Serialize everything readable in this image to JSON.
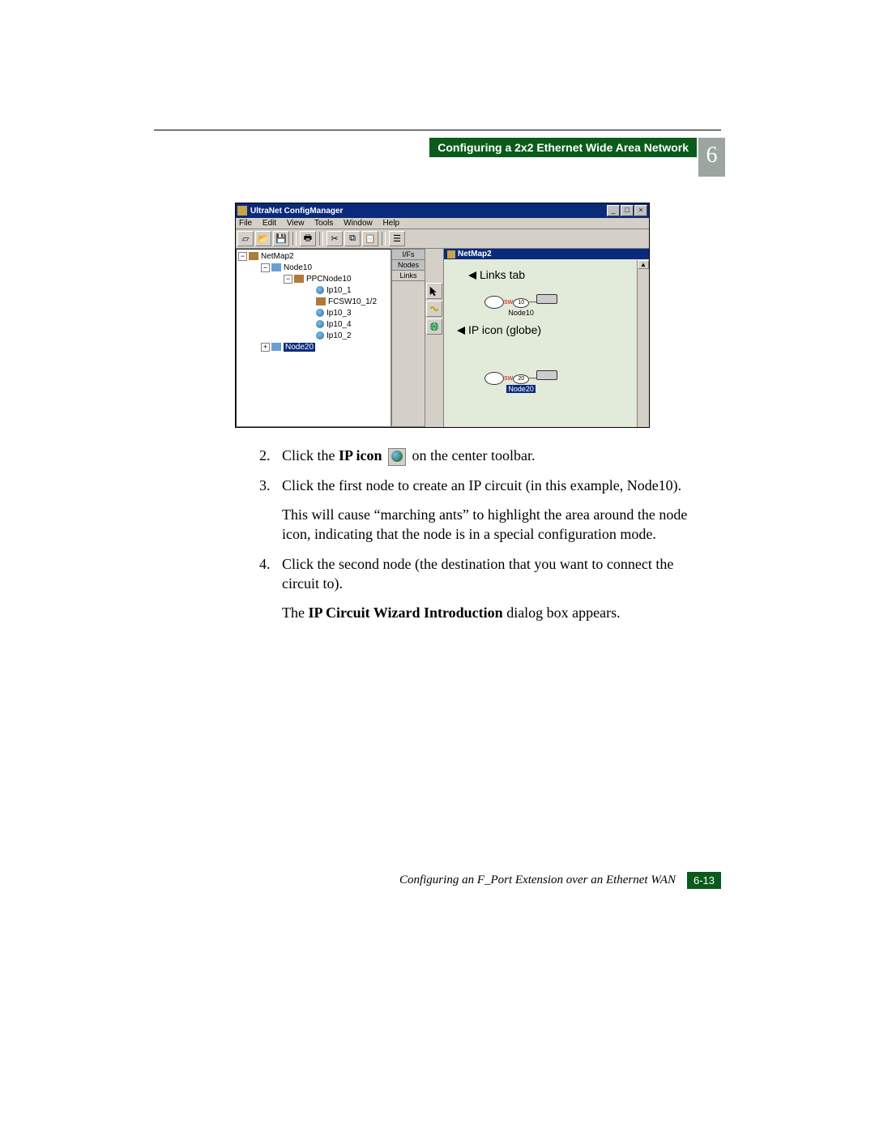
{
  "header": {
    "title": "Configuring a 2x2 Ethernet Wide Area Network",
    "chapter_number": "6"
  },
  "screenshot": {
    "window_title": "UltraNet ConfigManager",
    "menus": [
      "File",
      "Edit",
      "View",
      "Tools",
      "Window",
      "Help"
    ],
    "tree": {
      "root": "NetMap2",
      "node1": "Node10",
      "ppc": "PPCNode10",
      "items": [
        "Ip10_1",
        "FCSW10_1/2",
        "Ip10_3",
        "Ip10_4",
        "Ip10_2"
      ],
      "selected": "Node20"
    },
    "tabs": [
      "I/Fs",
      "Nodes",
      "Links"
    ],
    "canvas_title": "NetMap2",
    "annotations": {
      "links": "Links tab",
      "ip": "IP icon (globe)"
    },
    "canvas_nodes": {
      "n1_sw": "SW",
      "n1_num": "10",
      "n1_label": "Node10",
      "n2_sw": "SW",
      "n2_num": "20",
      "n2_label": "Node20"
    }
  },
  "steps": {
    "s2a": "Click the ",
    "s2_bold": "IP icon",
    "s2b": " on the center toolbar.",
    "s3": "Click the first node to create an IP circuit (in this example, Node10).",
    "s3_desc": "This will cause “marching ants” to highlight the area around the node icon, indicating that the node is in a special configuration mode.",
    "s4": "Click the second node (the destination that you want to connect the circuit to).",
    "s4_desc_a": "The ",
    "s4_desc_bold": "IP Circuit Wizard Introduction",
    "s4_desc_b": " dialog box appears."
  },
  "footer": {
    "text": "Configuring an F_Port Extension over an Ethernet WAN",
    "page": "6-13"
  }
}
